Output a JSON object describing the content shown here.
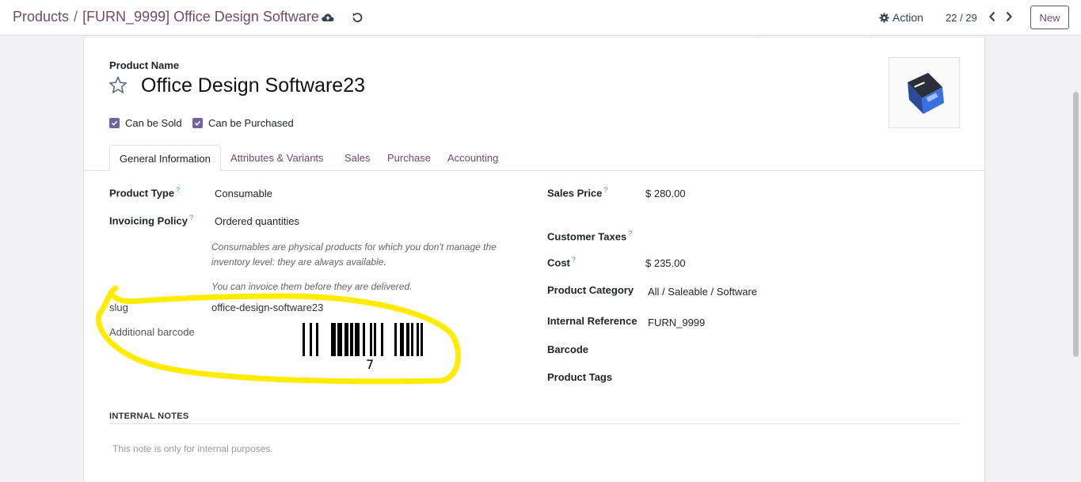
{
  "breadcrumb": {
    "parent": "Products",
    "separator": "/",
    "current": "[FURN_9999] Office Design Software"
  },
  "toolbar": {
    "action_label": "Action",
    "pager": "22 / 29",
    "new_label": "New"
  },
  "form": {
    "product_name_label": "Product Name",
    "product_name": "Office Design Software23",
    "can_be_sold_label": "Can be Sold",
    "can_be_purchased_label": "Can be Purchased",
    "tabs": [
      "General Information",
      "Attributes & Variants",
      "Sales",
      "Purchase",
      "Accounting"
    ],
    "left": {
      "product_type_label": "Product Type",
      "product_type_value": "Consumable",
      "invoicing_policy_label": "Invoicing Policy",
      "invoicing_policy_value": "Ordered quantities",
      "help_line1": "Consumables are physical products for which you don't manage the",
      "help_line2": "inventory level: they are always available.",
      "help_line3": "You can invoice them before they are delivered.",
      "slug_label": "slug",
      "slug_value": "office-design-software23",
      "additional_barcode_label": "Additional barcode",
      "barcode_digit": "7"
    },
    "right": {
      "sales_price_label": "Sales Price",
      "sales_price_value": "$ 280.00",
      "customer_taxes_label": "Customer Taxes",
      "cost_label": "Cost",
      "cost_value": "$ 235.00",
      "product_category_label": "Product Category",
      "product_category_value": "All / Saleable / Software",
      "internal_reference_label": "Internal Reference",
      "internal_reference_value": "FURN_9999",
      "barcode_label": "Barcode",
      "product_tags_label": "Product Tags"
    },
    "help_marker": "?",
    "internal_notes_header": "INTERNAL NOTES",
    "internal_notes_placeholder": "This note is only for internal purposes."
  },
  "colors": {
    "brand": "#714b67",
    "checkbox": "#71639e",
    "highlight": "#ffec00"
  }
}
